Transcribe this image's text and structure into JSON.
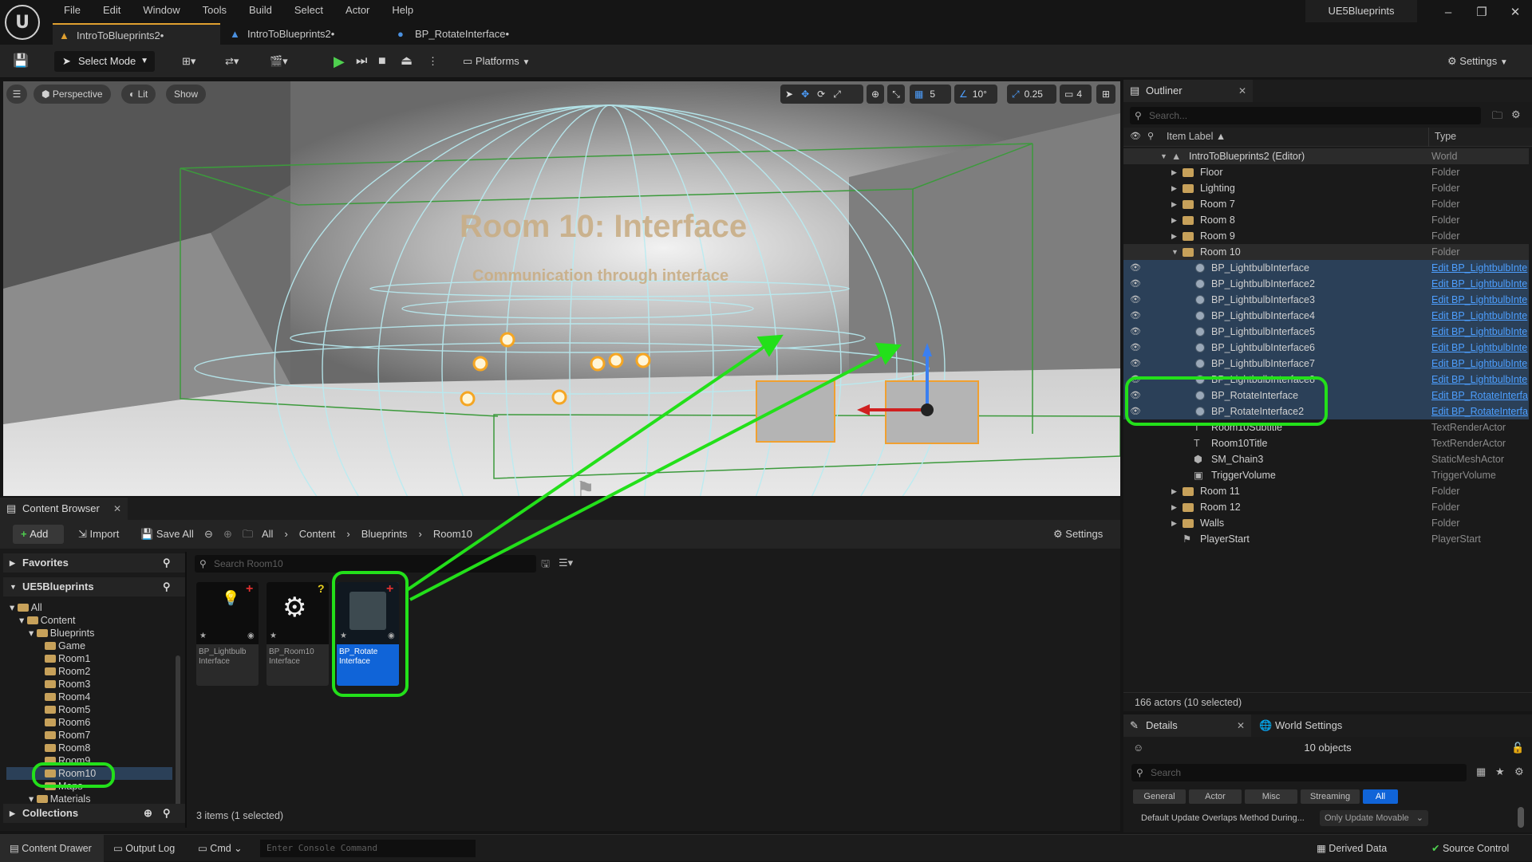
{
  "app": {
    "project_name": "UE5Blueprints",
    "menu": [
      "File",
      "Edit",
      "Window",
      "Tools",
      "Build",
      "Select",
      "Actor",
      "Help"
    ],
    "tabs": [
      "IntroToBlueprints2•",
      "IntroToBlueprints2•",
      "BP_RotateInterface•"
    ]
  },
  "toolbar": {
    "select_mode": "Select Mode",
    "platforms": "Platforms",
    "settings": "Settings"
  },
  "viewport": {
    "perspective": "Perspective",
    "lit": "Lit",
    "show": "Show",
    "grid_snap": "5",
    "angle_snap": "10°",
    "scale_snap": "0.25",
    "camera_speed": "4",
    "room_title": "Room 10: Interface",
    "room_subtitle": "Communication through interface",
    "axis_z": "Z",
    "axis_x": "X",
    "axis_y": "Y"
  },
  "outliner": {
    "title": "Outliner",
    "search_placeholder": "Search...",
    "col_label": "Item Label ▲",
    "col_type": "Type",
    "rows": [
      {
        "label": "IntroToBlueprints2 (Editor)",
        "type": "World"
      },
      {
        "label": "Floor",
        "type": "Folder"
      },
      {
        "label": "Lighting",
        "type": "Folder"
      },
      {
        "label": "Room 7",
        "type": "Folder"
      },
      {
        "label": "Room 8",
        "type": "Folder"
      },
      {
        "label": "Room 9",
        "type": "Folder"
      },
      {
        "label": "Room 10",
        "type": "Folder"
      },
      {
        "label": "BP_LightbulbInterface",
        "type": "Edit BP_LightbulbInte"
      },
      {
        "label": "BP_LightbulbInterface2",
        "type": "Edit BP_LightbulbInte"
      },
      {
        "label": "BP_LightbulbInterface3",
        "type": "Edit BP_LightbulbInte"
      },
      {
        "label": "BP_LightbulbInterface4",
        "type": "Edit BP_LightbulbInte"
      },
      {
        "label": "BP_LightbulbInterface5",
        "type": "Edit BP_LightbulbInte"
      },
      {
        "label": "BP_LightbulbInterface6",
        "type": "Edit BP_LightbulbInte"
      },
      {
        "label": "BP_LightbulbInterface7",
        "type": "Edit BP_LightbulbInte"
      },
      {
        "label": "BP_LightbulbInterface8",
        "type": "Edit BP_LightbulbInte"
      },
      {
        "label": "BP_RotateInterface",
        "type": "Edit BP_RotateInterfa"
      },
      {
        "label": "BP_RotateInterface2",
        "type": "Edit BP_RotateInterfa"
      },
      {
        "label": "Room10Subtitle",
        "type": "TextRenderActor"
      },
      {
        "label": "Room10Title",
        "type": "TextRenderActor"
      },
      {
        "label": "SM_Chain3",
        "type": "StaticMeshActor"
      },
      {
        "label": "TriggerVolume",
        "type": "TriggerVolume"
      },
      {
        "label": "Room 11",
        "type": "Folder"
      },
      {
        "label": "Room 12",
        "type": "Folder"
      },
      {
        "label": "Walls",
        "type": "Folder"
      },
      {
        "label": "PlayerStart",
        "type": "PlayerStart"
      }
    ],
    "actor_count": "166 actors (10 selected)"
  },
  "details": {
    "title": "Details",
    "world_settings": "World Settings",
    "objects": "10 objects",
    "search_placeholder": "Search",
    "filters": [
      "General",
      "Actor",
      "Misc",
      "Streaming",
      "All"
    ],
    "property_label": "Default Update Overlaps Method During...",
    "property_value": "Only Update Movable"
  },
  "content_browser": {
    "title": "Content Browser",
    "add": "Add",
    "import": "Import",
    "save_all": "Save All",
    "breadcrumb": [
      "All",
      "Content",
      "Blueprints",
      "Room10"
    ],
    "settings": "Settings",
    "favorites": "Favorites",
    "project": "UE5Blueprints",
    "search_placeholder": "Search Room10",
    "tree": [
      "All",
      "Content",
      "Blueprints",
      "Game",
      "Room1",
      "Room2",
      "Room3",
      "Room4",
      "Room5",
      "Room6",
      "Room7",
      "Room8",
      "Room9",
      "Room10",
      "Maps",
      "Materials"
    ],
    "collections": "Collections",
    "assets": [
      {
        "line1": "BP_Lightbulb",
        "line2": "Interface"
      },
      {
        "line1": "BP_Room10",
        "line2": "Interface"
      },
      {
        "line1": "BP_Rotate",
        "line2": "Interface"
      }
    ],
    "item_count": "3 items (1 selected)"
  },
  "statusbar": {
    "content_drawer": "Content Drawer",
    "output_log": "Output Log",
    "cmd": "Cmd",
    "console_placeholder": "Enter Console Command",
    "derived_data": "Derived Data",
    "source_control": "Source Control"
  },
  "highlight_color": "#23e01a"
}
